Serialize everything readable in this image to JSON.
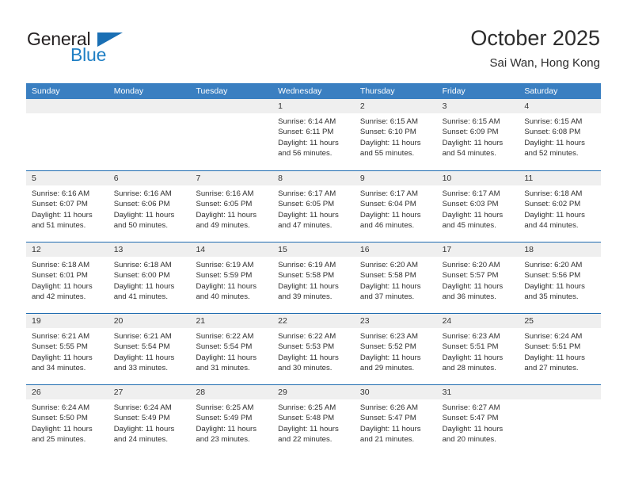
{
  "brand": {
    "name_top": "General",
    "name_bottom": "Blue",
    "triangle_icon": "triangle-icon",
    "color_dark": "#231f20",
    "color_blue": "#1f7fc4"
  },
  "header": {
    "title": "October 2025",
    "subtitle": "Sai Wan, Hong Kong"
  },
  "theme": {
    "header_bar": "#3a7fc1",
    "week_divider": "#1f6cb0",
    "date_band": "#efefef",
    "text": "#2f2f2f"
  },
  "calendar": {
    "weekday_headers": [
      "Sunday",
      "Monday",
      "Tuesday",
      "Wednesday",
      "Thursday",
      "Friday",
      "Saturday"
    ],
    "weeks": [
      [
        {
          "date": "",
          "lines": [],
          "empty": true
        },
        {
          "date": "",
          "lines": [],
          "empty": true
        },
        {
          "date": "",
          "lines": [],
          "empty": true
        },
        {
          "date": "1",
          "lines": [
            "Sunrise: 6:14 AM",
            "Sunset: 6:11 PM",
            "Daylight: 11 hours",
            "and 56 minutes."
          ],
          "empty": false
        },
        {
          "date": "2",
          "lines": [
            "Sunrise: 6:15 AM",
            "Sunset: 6:10 PM",
            "Daylight: 11 hours",
            "and 55 minutes."
          ],
          "empty": false
        },
        {
          "date": "3",
          "lines": [
            "Sunrise: 6:15 AM",
            "Sunset: 6:09 PM",
            "Daylight: 11 hours",
            "and 54 minutes."
          ],
          "empty": false
        },
        {
          "date": "4",
          "lines": [
            "Sunrise: 6:15 AM",
            "Sunset: 6:08 PM",
            "Daylight: 11 hours",
            "and 52 minutes."
          ],
          "empty": false
        }
      ],
      [
        {
          "date": "5",
          "lines": [
            "Sunrise: 6:16 AM",
            "Sunset: 6:07 PM",
            "Daylight: 11 hours",
            "and 51 minutes."
          ],
          "empty": false
        },
        {
          "date": "6",
          "lines": [
            "Sunrise: 6:16 AM",
            "Sunset: 6:06 PM",
            "Daylight: 11 hours",
            "and 50 minutes."
          ],
          "empty": false
        },
        {
          "date": "7",
          "lines": [
            "Sunrise: 6:16 AM",
            "Sunset: 6:05 PM",
            "Daylight: 11 hours",
            "and 49 minutes."
          ],
          "empty": false
        },
        {
          "date": "8",
          "lines": [
            "Sunrise: 6:17 AM",
            "Sunset: 6:05 PM",
            "Daylight: 11 hours",
            "and 47 minutes."
          ],
          "empty": false
        },
        {
          "date": "9",
          "lines": [
            "Sunrise: 6:17 AM",
            "Sunset: 6:04 PM",
            "Daylight: 11 hours",
            "and 46 minutes."
          ],
          "empty": false
        },
        {
          "date": "10",
          "lines": [
            "Sunrise: 6:17 AM",
            "Sunset: 6:03 PM",
            "Daylight: 11 hours",
            "and 45 minutes."
          ],
          "empty": false
        },
        {
          "date": "11",
          "lines": [
            "Sunrise: 6:18 AM",
            "Sunset: 6:02 PM",
            "Daylight: 11 hours",
            "and 44 minutes."
          ],
          "empty": false
        }
      ],
      [
        {
          "date": "12",
          "lines": [
            "Sunrise: 6:18 AM",
            "Sunset: 6:01 PM",
            "Daylight: 11 hours",
            "and 42 minutes."
          ],
          "empty": false
        },
        {
          "date": "13",
          "lines": [
            "Sunrise: 6:18 AM",
            "Sunset: 6:00 PM",
            "Daylight: 11 hours",
            "and 41 minutes."
          ],
          "empty": false
        },
        {
          "date": "14",
          "lines": [
            "Sunrise: 6:19 AM",
            "Sunset: 5:59 PM",
            "Daylight: 11 hours",
            "and 40 minutes."
          ],
          "empty": false
        },
        {
          "date": "15",
          "lines": [
            "Sunrise: 6:19 AM",
            "Sunset: 5:58 PM",
            "Daylight: 11 hours",
            "and 39 minutes."
          ],
          "empty": false
        },
        {
          "date": "16",
          "lines": [
            "Sunrise: 6:20 AM",
            "Sunset: 5:58 PM",
            "Daylight: 11 hours",
            "and 37 minutes."
          ],
          "empty": false
        },
        {
          "date": "17",
          "lines": [
            "Sunrise: 6:20 AM",
            "Sunset: 5:57 PM",
            "Daylight: 11 hours",
            "and 36 minutes."
          ],
          "empty": false
        },
        {
          "date": "18",
          "lines": [
            "Sunrise: 6:20 AM",
            "Sunset: 5:56 PM",
            "Daylight: 11 hours",
            "and 35 minutes."
          ],
          "empty": false
        }
      ],
      [
        {
          "date": "19",
          "lines": [
            "Sunrise: 6:21 AM",
            "Sunset: 5:55 PM",
            "Daylight: 11 hours",
            "and 34 minutes."
          ],
          "empty": false
        },
        {
          "date": "20",
          "lines": [
            "Sunrise: 6:21 AM",
            "Sunset: 5:54 PM",
            "Daylight: 11 hours",
            "and 33 minutes."
          ],
          "empty": false
        },
        {
          "date": "21",
          "lines": [
            "Sunrise: 6:22 AM",
            "Sunset: 5:54 PM",
            "Daylight: 11 hours",
            "and 31 minutes."
          ],
          "empty": false
        },
        {
          "date": "22",
          "lines": [
            "Sunrise: 6:22 AM",
            "Sunset: 5:53 PM",
            "Daylight: 11 hours",
            "and 30 minutes."
          ],
          "empty": false
        },
        {
          "date": "23",
          "lines": [
            "Sunrise: 6:23 AM",
            "Sunset: 5:52 PM",
            "Daylight: 11 hours",
            "and 29 minutes."
          ],
          "empty": false
        },
        {
          "date": "24",
          "lines": [
            "Sunrise: 6:23 AM",
            "Sunset: 5:51 PM",
            "Daylight: 11 hours",
            "and 28 minutes."
          ],
          "empty": false
        },
        {
          "date": "25",
          "lines": [
            "Sunrise: 6:24 AM",
            "Sunset: 5:51 PM",
            "Daylight: 11 hours",
            "and 27 minutes."
          ],
          "empty": false
        }
      ],
      [
        {
          "date": "26",
          "lines": [
            "Sunrise: 6:24 AM",
            "Sunset: 5:50 PM",
            "Daylight: 11 hours",
            "and 25 minutes."
          ],
          "empty": false
        },
        {
          "date": "27",
          "lines": [
            "Sunrise: 6:24 AM",
            "Sunset: 5:49 PM",
            "Daylight: 11 hours",
            "and 24 minutes."
          ],
          "empty": false
        },
        {
          "date": "28",
          "lines": [
            "Sunrise: 6:25 AM",
            "Sunset: 5:49 PM",
            "Daylight: 11 hours",
            "and 23 minutes."
          ],
          "empty": false
        },
        {
          "date": "29",
          "lines": [
            "Sunrise: 6:25 AM",
            "Sunset: 5:48 PM",
            "Daylight: 11 hours",
            "and 22 minutes."
          ],
          "empty": false
        },
        {
          "date": "30",
          "lines": [
            "Sunrise: 6:26 AM",
            "Sunset: 5:47 PM",
            "Daylight: 11 hours",
            "and 21 minutes."
          ],
          "empty": false
        },
        {
          "date": "31",
          "lines": [
            "Sunrise: 6:27 AM",
            "Sunset: 5:47 PM",
            "Daylight: 11 hours",
            "and 20 minutes."
          ],
          "empty": false
        },
        {
          "date": "",
          "lines": [],
          "empty": true
        }
      ]
    ]
  }
}
